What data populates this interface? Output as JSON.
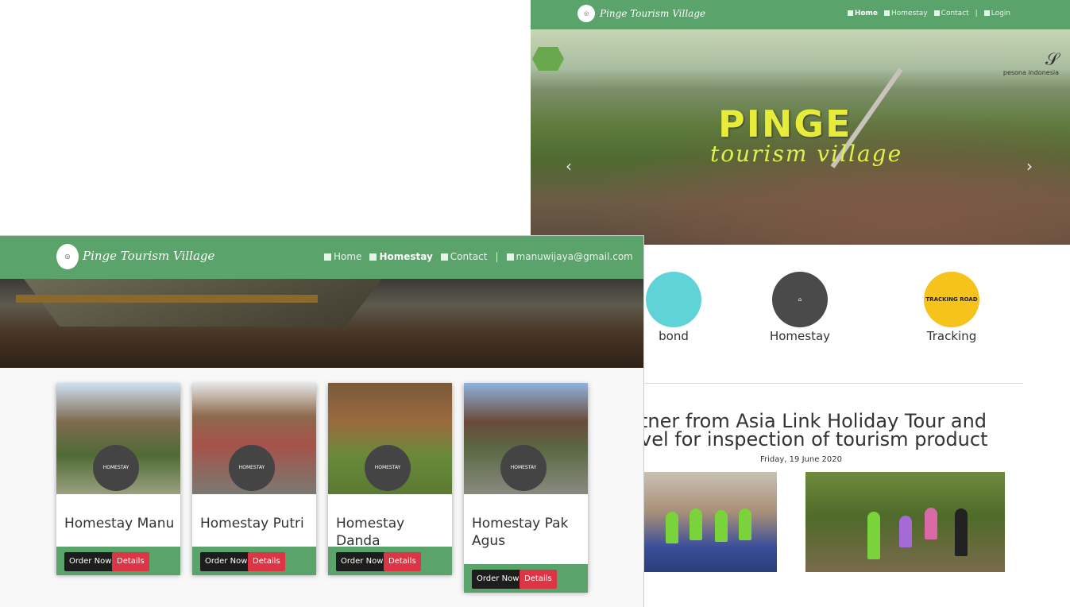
{
  "right": {
    "brand": "Pinge Tourism Village",
    "nav": {
      "home": "Home",
      "homestay": "Homestay",
      "contact": "Contact",
      "separator": "|",
      "login": "Login"
    },
    "hero": {
      "title": "PINGE",
      "subtitle": "tourism village",
      "logo_text": "pesona indonesia",
      "prev_arrow": "‹",
      "next_arrow": "›"
    },
    "services": [
      {
        "label": "bond",
        "color": "#5fd3d6"
      },
      {
        "label": "Homestay",
        "color": "#4a4a4a"
      },
      {
        "label": "Tracking",
        "color": "#f6c21c",
        "circle_text": "TRACKING ROAD"
      }
    ],
    "news": {
      "title_line1": "tner from Asia Link Holiday Tour and",
      "title_line2": "vel for inspection of tourism product",
      "date": "Friday, 19 June 2020"
    }
  },
  "left": {
    "brand": "Pinge Tourism Village",
    "nav": {
      "home": "Home",
      "homestay": "Homestay",
      "contact": "Contact",
      "separator": "|",
      "user": "manuwijaya@gmail.com"
    },
    "cards": [
      {
        "name": "Homestay Manu",
        "order": "Order Now",
        "details": "Details"
      },
      {
        "name": "Homestay Putri",
        "order": "Order Now",
        "details": "Details"
      },
      {
        "name": "Homestay Danda",
        "order": "Order Now",
        "details": "Details"
      },
      {
        "name": "Homestay Pak Agus",
        "order": "Order Now",
        "details": "Details"
      }
    ],
    "card_logo_text": "HOMESTAY"
  },
  "colors": {
    "nav_green": "#5aa36a",
    "danger": "#dc3545",
    "dark_button": "#1d1d1d"
  }
}
